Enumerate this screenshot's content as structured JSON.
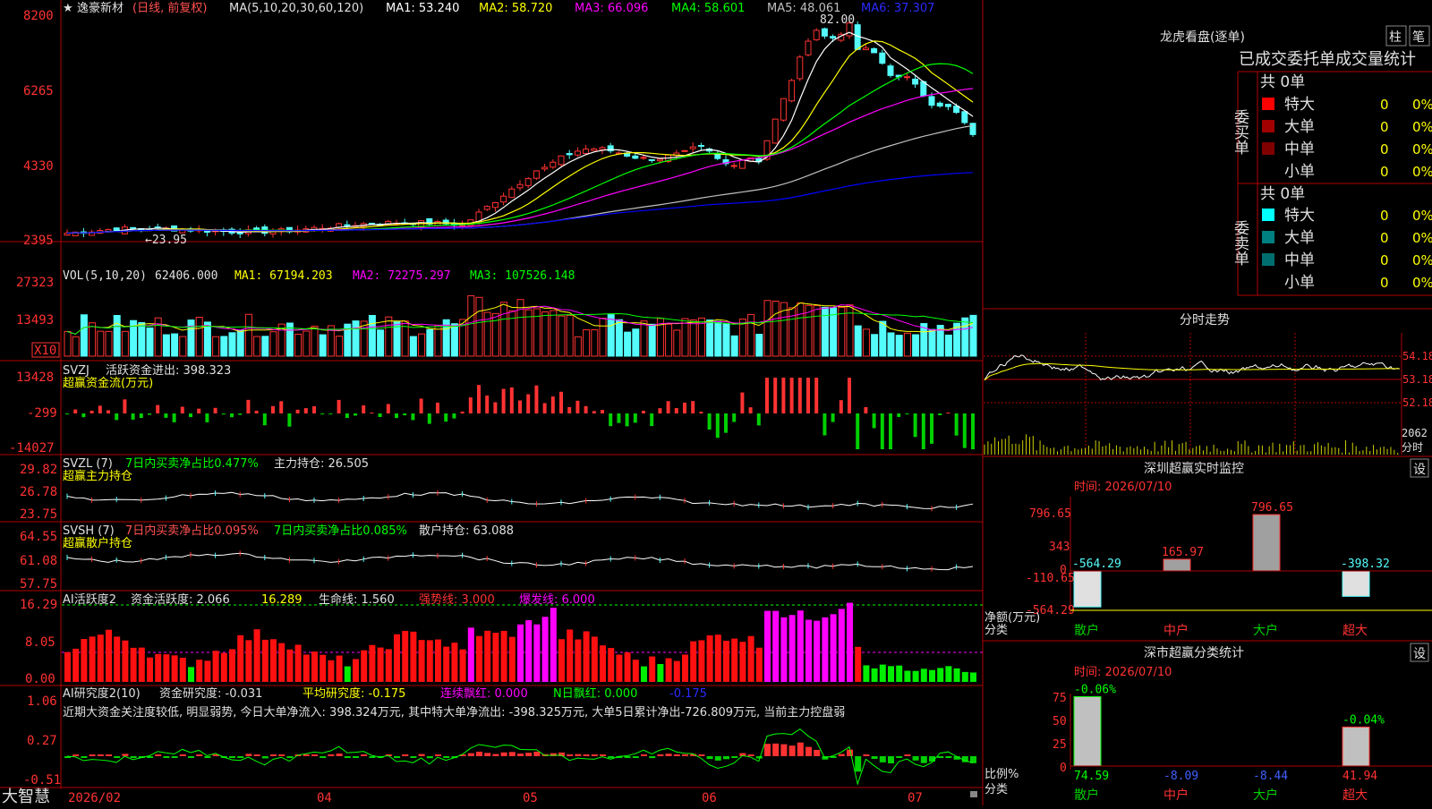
{
  "app": {
    "name": "大智慧"
  },
  "colors": {
    "up": "#ff3232",
    "down": "#54fcfc",
    "axis": "#b00000",
    "bg": "#000000",
    "ma1": "#ffffff",
    "ma2": "#ffff00",
    "ma3": "#ff00ff",
    "ma4": "#00ff00",
    "ma5": "#c0c0c0",
    "ma6": "#0000ff",
    "label_red": "#ff5050",
    "label_white": "#e0e0e0"
  },
  "price_panel": {
    "star": "★",
    "stock": "逸豪新材",
    "mode": "(日线, 前复权)",
    "ma_spec": "MA(5,10,20,30,60,120)",
    "ma1": "MA1: 53.240",
    "ma2": "MA2: 58.720",
    "ma3": "MA3: 66.096",
    "ma4": "MA4: 58.601",
    "ma5": "MA5: 48.061",
    "ma6": "MA6: 37.307",
    "high_label": "82.00",
    "low_label": "←23.95",
    "y_ticks": [
      "8200",
      "6265",
      "4330",
      "2395"
    ]
  },
  "vol_panel": {
    "title": "VOL(5,10,20)",
    "value": "62406.000",
    "ma1": "MA1: 67194.203",
    "ma2": "MA2: 72275.297",
    "ma3": "MA3: 107526.148",
    "y_ticks": [
      "27323",
      "13493"
    ],
    "unit": "X10"
  },
  "svzj_panel": {
    "title": "SVZJ",
    "line1": "活跃资金进出: 398.323",
    "line2": "超赢资金流(万元)",
    "y_ticks": [
      "13428",
      "-299",
      "-14027"
    ]
  },
  "svzl_panel": {
    "title": "SVZL (7)",
    "part1": "7日内买卖净占比0.477%",
    "part2": "主力持仓: 26.505",
    "line2": "超赢主力持仓",
    "y_ticks": [
      "29.82",
      "26.78",
      "23.75"
    ]
  },
  "svsh_panel": {
    "title": "SVSH (7)",
    "part1": "7日内买卖净占比0.095%",
    "part2": "7日内买卖净占比0.085%",
    "part3": "散户持仓: 63.088",
    "line2": "超赢散户持仓",
    "y_ticks": [
      "64.55",
      "61.08",
      "57.75"
    ]
  },
  "ai_panel": {
    "title": "AI活跃度2",
    "p1": "资金活跃度: 2.066",
    "p2": "16.289",
    "p3": "生命线: 1.560",
    "p4": "强势线: 3.000",
    "p5": "爆发线: 6.000",
    "y_ticks": [
      "16.29",
      "8.05",
      "0.00"
    ]
  },
  "research_panel": {
    "title": "AI研究度2(10)",
    "p1": "资金研究度: -0.031",
    "p2": "平均研究度: -0.175",
    "p3": "连续飘红: 0.000",
    "p4": "N日飘红: 0.000",
    "p5": "-0.175",
    "text": "近期大资金关注度较低, 明显弱势, 今日大单净流入: 398.324万元, 其中特大单净流出: -398.325万元, 大单5日累计净出-726.809万元, 当前主力控盘弱",
    "y_ticks": [
      "1.06",
      "0.27",
      "-0.51"
    ]
  },
  "x_axis": {
    "labels": [
      "2026/02",
      "04",
      "05",
      "06",
      "07"
    ]
  },
  "right_panel": {
    "lhb_title": "龙虎看盘(逐单)",
    "btn_zhu": "柱",
    "btn_bi": "笔",
    "stat_header": "已成交委托单成交量统计",
    "buy_label": "委买单",
    "sell_label": "委卖单",
    "buy_total": "共 0单",
    "sell_total": "共 0单",
    "rows": [
      {
        "name": "特大",
        "count": "0",
        "pct": "0%"
      },
      {
        "name": "大单",
        "count": "0",
        "pct": "0%"
      },
      {
        "name": "中单",
        "count": "0",
        "pct": "0%"
      },
      {
        "name": "小单",
        "count": "0",
        "pct": "0%"
      }
    ],
    "buy_swatches": [
      "#ff0000",
      "#a00000",
      "#800000",
      "#000000"
    ],
    "sell_swatches": [
      "#00ffff",
      "#008080",
      "#006e6e",
      "#000000"
    ],
    "intraday_title": "分时走势",
    "intraday_ticks": [
      "54.18",
      "53.18",
      "52.18",
      "2062",
      "分时"
    ],
    "monitor_title": "深圳超赢实时监控",
    "monitor_date": "时间: 2026/07/10",
    "monitor_y_ticks": [
      "796.65",
      "343",
      "0",
      "-110.65",
      "-564.29"
    ],
    "monitor_ylabel": "净额(万元)",
    "monitor_xlabel": "分类",
    "settings": "设",
    "class_title": "深市超赢分类统计",
    "class_date": "时间: 2026/07/10",
    "class_y_ticks": [
      "75",
      "50",
      "25",
      "0"
    ],
    "class_ylabel": "比例%",
    "class_xlabel": "分类"
  },
  "chart_data": [
    {
      "type": "bar",
      "title": "深圳超赢实时监控",
      "ylabel": "净额(万元)",
      "xlabel": "分类",
      "categories": [
        "散户",
        "中户",
        "大户",
        "超大"
      ],
      "values": [
        -564.29,
        165.97,
        796.65,
        -398.32
      ],
      "value_labels": [
        "-564.29",
        "165.97",
        "796.65",
        "-398.32"
      ],
      "ylim": [
        -564.29,
        796.65
      ]
    },
    {
      "type": "bar",
      "title": "深市超赢分类统计",
      "ylabel": "比例%",
      "xlabel": "分类",
      "categories": [
        "散户",
        "中户",
        "大户",
        "超大"
      ],
      "values": [
        74.59,
        0,
        0,
        41.94
      ],
      "bottom_labels": [
        "74.59",
        "-8.09",
        "-8.44",
        "41.94"
      ],
      "top_labels": [
        "-0.06%",
        "",
        "",
        "-0.04%"
      ],
      "ylim": [
        0,
        75
      ]
    },
    {
      "type": "line",
      "title": "逸豪新材 日线",
      "x": [
        "2026/02",
        "04",
        "05",
        "06",
        "07"
      ],
      "ylim": [
        23.95,
        82.0
      ],
      "price_ticks": [
        82.0,
        62.65,
        43.3,
        23.95
      ],
      "series": [
        {
          "name": "MA1",
          "last": 53.24
        },
        {
          "name": "MA2",
          "last": 58.72
        },
        {
          "name": "MA3",
          "last": 66.096
        },
        {
          "name": "MA4",
          "last": 58.601
        },
        {
          "name": "MA5",
          "last": 48.061
        },
        {
          "name": "MA6",
          "last": 37.307
        }
      ],
      "annotations": [
        "82.00",
        "←23.95"
      ]
    }
  ]
}
